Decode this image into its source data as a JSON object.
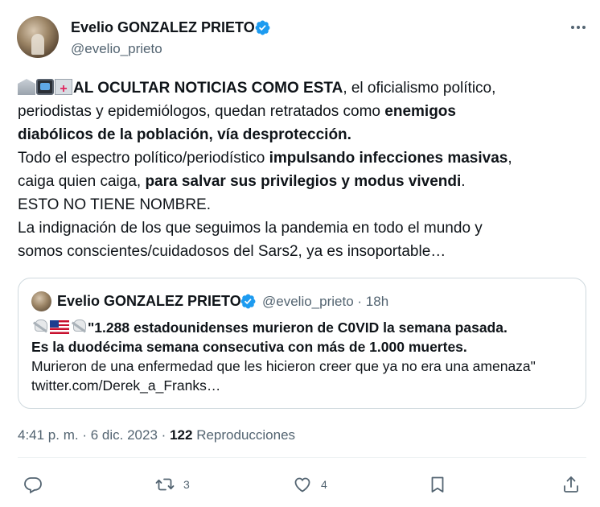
{
  "author": {
    "name": "Evelio GONZALEZ PRIETO",
    "handle": "@evelio_prieto",
    "verified": true,
    "verified_color": "#1d9bf0"
  },
  "tweet": {
    "emoji_prefix": [
      "classical-building",
      "television",
      "hospital"
    ],
    "lines": [
      {
        "bold": "AL OCULTAR NOTICIAS COMO ESTA",
        "text": ", el oficialismo político,"
      },
      {
        "text": "periodistas y epidemiólogos, quedan retratados como ",
        "bold": "enemigos"
      },
      {
        "bold": "diabólicos de la población, vía desprotección."
      },
      {
        "text": "Todo el espectro político/periodístico ",
        "bold": "impulsando infecciones masivas",
        "text2": ","
      },
      {
        "text": "caiga quien caiga, ",
        "bold": "para salvar sus privilegios y modus vivendi",
        "text2": "."
      },
      {
        "text": "ESTO NO TIENE NOMBRE."
      },
      {
        "text": "La indignación de los que seguimos la pandemia en todo el mundo y"
      },
      {
        "text": "somos conscientes/cuidadosos del Sars2, ya es insoportable…"
      }
    ]
  },
  "quote": {
    "name": "Evelio GONZALEZ PRIETO",
    "handle": "@evelio_prieto",
    "separator": "·",
    "age": "18h",
    "emoji_prefix": [
      "skull-and-crossbones",
      "us-flag",
      "skull-and-crossbones"
    ],
    "line1": "\"1.288 estadounidenses murieron de C0VID la semana pasada.",
    "line2": "Es la duodécima semana consecutiva con más de 1.000 muertes.",
    "line3": "Murieron de una enfermedad que les hicieron creer que ya no era una amenaza\"",
    "line4": "twitter.com/Derek_a_Franks…"
  },
  "meta": {
    "time": "4:41 p. m.",
    "separator": "·",
    "date": "6 dic. 2023",
    "views_count": "122",
    "views_label": "Reproducciones"
  },
  "actions": {
    "reply_count": "",
    "retweet_count": "3",
    "like_count": "4"
  },
  "colors": {
    "text": "#0f1419",
    "secondary": "#536471",
    "border": "#cfd9de",
    "accent": "#1d9bf0"
  }
}
